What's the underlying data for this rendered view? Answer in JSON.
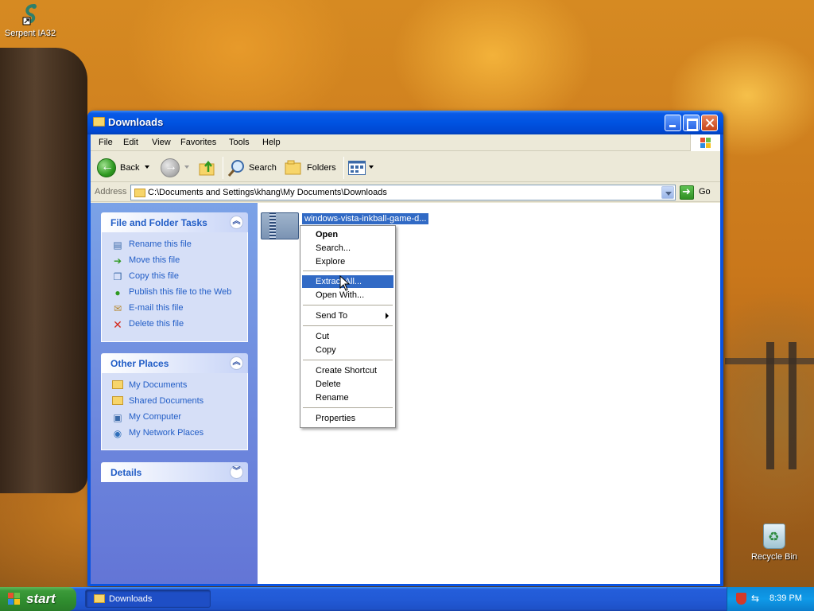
{
  "desktop": {
    "icons": [
      {
        "label": "Serpent IA32",
        "icon": "serpent-app-icon"
      },
      {
        "label": "Recycle Bin",
        "icon": "recycle-bin-icon"
      }
    ]
  },
  "window": {
    "title": "Downloads",
    "menu": [
      "File",
      "Edit",
      "View",
      "Favorites",
      "Tools",
      "Help"
    ],
    "toolbar": {
      "back_label": "Back",
      "search_label": "Search",
      "folders_label": "Folders"
    },
    "address": {
      "label": "Address",
      "value": "C:\\Documents and Settings\\khang\\My Documents\\Downloads",
      "go_label": "Go"
    },
    "taskpane": {
      "file_folder_tasks": {
        "title": "File and Folder Tasks",
        "items": [
          {
            "label": "Rename this file",
            "icon": "rename-icon"
          },
          {
            "label": "Move this file",
            "icon": "move-icon"
          },
          {
            "label": "Copy this file",
            "icon": "copy-icon"
          },
          {
            "label": "Publish this file to the Web",
            "icon": "globe-icon"
          },
          {
            "label": "E-mail this file",
            "icon": "email-icon"
          },
          {
            "label": "Delete this file",
            "icon": "delete-icon"
          }
        ]
      },
      "other_places": {
        "title": "Other Places",
        "items": [
          {
            "label": "My Documents",
            "icon": "folder-icon"
          },
          {
            "label": "Shared Documents",
            "icon": "folder-icon"
          },
          {
            "label": "My Computer",
            "icon": "computer-icon"
          },
          {
            "label": "My Network Places",
            "icon": "network-icon"
          }
        ]
      },
      "details": {
        "title": "Details"
      }
    },
    "files": [
      {
        "name": "windows-vista-inkball-game-d...",
        "icon": "zip-folder-icon",
        "selected": true
      }
    ]
  },
  "context_menu": {
    "items": [
      {
        "label": "Open",
        "bold": true
      },
      {
        "label": "Search..."
      },
      {
        "label": "Explore"
      },
      {
        "label": "Extract All...",
        "highlighted": true
      },
      {
        "label": "Open With..."
      },
      {
        "label": "Send To",
        "submenu": true
      },
      {
        "label": "Cut"
      },
      {
        "label": "Copy"
      },
      {
        "label": "Create Shortcut"
      },
      {
        "label": "Delete"
      },
      {
        "label": "Rename"
      },
      {
        "label": "Properties"
      }
    ]
  },
  "taskbar": {
    "start_label": "start",
    "task_label": "Downloads",
    "clock": "8:39 PM"
  },
  "colors": {
    "title_blue": "#0053e1",
    "selection_blue": "#316ac5",
    "task_link_blue": "#215dc6",
    "start_green": "#3c9a3a"
  }
}
